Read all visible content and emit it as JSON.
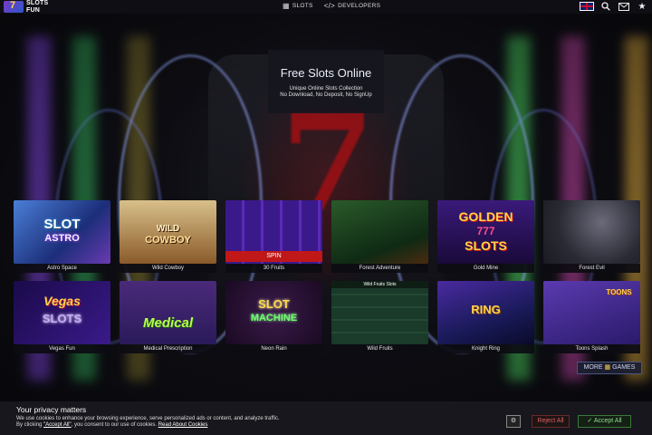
{
  "header": {
    "logo_line1": "SLOTS",
    "logo_line2": "FUN",
    "nav": [
      {
        "label": "SLOTS",
        "icon": "slots-icon"
      },
      {
        "label": "DEVELOPERS",
        "icon": "code-icon"
      }
    ],
    "right_icons": [
      "uk-flag-icon",
      "search-icon",
      "mail-icon",
      "star-icon"
    ]
  },
  "hero": {
    "title": "Free Slots Online",
    "line1": "Unique Online Slots Collection",
    "line2": "No Download, No Deposit, No SignUp"
  },
  "games": [
    {
      "name": "Astro Space",
      "art": "SLOT ASTRO"
    },
    {
      "name": "Wild Cowboy",
      "art": "WILD COWBOY"
    },
    {
      "name": "30 Fruits",
      "art": "SPIN"
    },
    {
      "name": "Forest Adventure",
      "art": ""
    },
    {
      "name": "Gold Mine",
      "art": "GOLDEN 777 SLOTS"
    },
    {
      "name": "Forest Evil",
      "art": ""
    },
    {
      "name": "Vegas Fun",
      "art": "Vegas SLOTS"
    },
    {
      "name": "Medical Prescription",
      "art": "Medical"
    },
    {
      "name": "Neon Rain",
      "art": "SLOT MACHINE"
    },
    {
      "name": "Wild Fruits",
      "art": "Wild Fruits Slots"
    },
    {
      "name": "Knight Ring",
      "art": "RING"
    },
    {
      "name": "Toons Splash",
      "art": "TOONS SLOT"
    }
  ],
  "more_button": {
    "label_left": "MORE",
    "icon": "slot-machine-icon",
    "label_right": "GAMES"
  },
  "privacy": {
    "title": "Your privacy matters",
    "text1": "We use cookies to enhance your browsing experience, serve personalized ads or content, and analyze traffic.",
    "text2_prefix": "By clicking ",
    "text2_link": "\"Accept All\"",
    "text2_suffix": ", you consent to our use of cookies. ",
    "text2_link2": "Read About Cookies",
    "reject": "Reject All",
    "accept": "Accept All"
  },
  "colors": {
    "accent": "#ffd24a",
    "reject": "#e06060",
    "accept": "#8fe08f"
  }
}
